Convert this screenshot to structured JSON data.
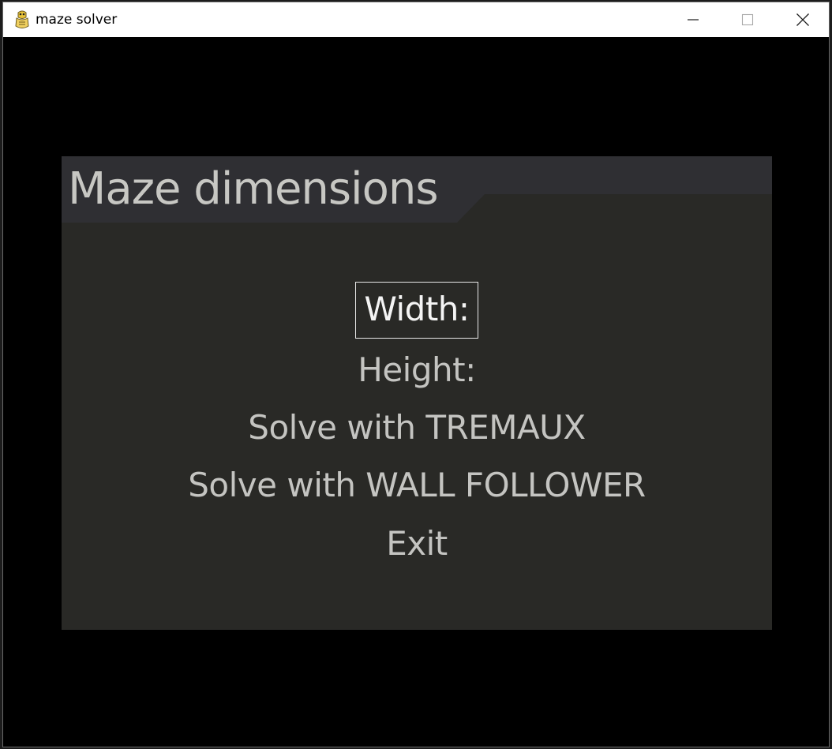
{
  "window": {
    "title": "maze solver",
    "app_icon": "python-snake-icon",
    "controls": [
      "minimize-icon",
      "maximize-icon",
      "close-icon"
    ]
  },
  "menu": {
    "title": "Maze dimensions",
    "selected_index": 0,
    "items": [
      {
        "label": "Width: "
      },
      {
        "label": "Height: "
      },
      {
        "label": "Solve with TREMAUX"
      },
      {
        "label": "Solve with WALL FOLLOWER"
      },
      {
        "label": "Exit"
      }
    ]
  },
  "colors": {
    "background": "#000000",
    "panel": "#292926",
    "title_bar": "#2f2f33",
    "text": "#c4c4c1",
    "selected_text": "#f4f4f4",
    "selected_border": "#e8e8e8"
  }
}
